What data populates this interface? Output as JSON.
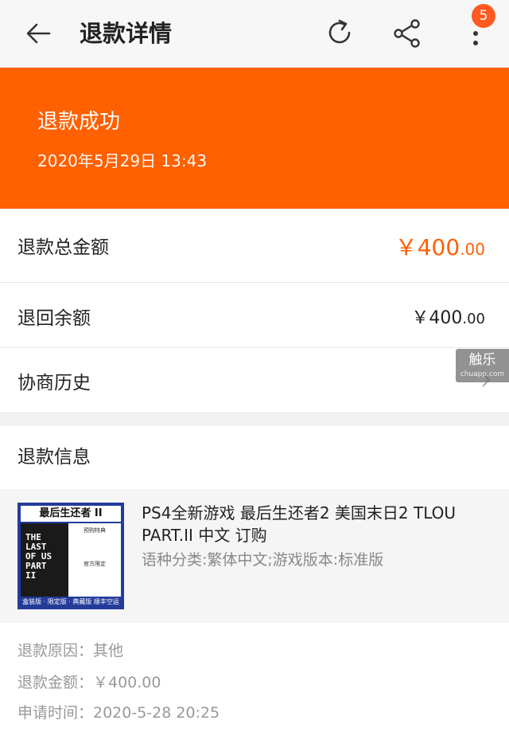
{
  "header": {
    "title": "退款详情",
    "badge_count": "5"
  },
  "banner": {
    "status": "退款成功",
    "time": "2020年5月29日 13:43",
    "color": "#ff6000"
  },
  "rows": {
    "total_label": "退款总金额",
    "total_amount_main": "￥400",
    "total_amount_dec": ".00",
    "balance_label": "退回余额",
    "balance_amount_main": "￥400",
    "balance_amount_dec": ".00",
    "history_label": "协商历史"
  },
  "watermark": {
    "main": "触乐",
    "sub": "chuapp.com"
  },
  "refund_info": {
    "section_title": "退款信息",
    "product": {
      "name": "PS4全新游戏 最后生还者2 美国末日2 TLOU PART.II 中文 订购",
      "spec": "语种分类:繁体中文;游戏版本:标准版",
      "thumb_title": "最后生还者 II",
      "thumb_game_title": "THE LAST OF US PART II",
      "thumb_side_1": "预购特典",
      "thumb_side_2": "官方限定",
      "thumb_bottom": "盒装版 · 限定版 · 典藏版 顺丰空运"
    },
    "reason": "退款原因：其他",
    "amount": "退款金额：￥400.00",
    "apply_time": "申请时间：2020-5-28 20:25"
  }
}
